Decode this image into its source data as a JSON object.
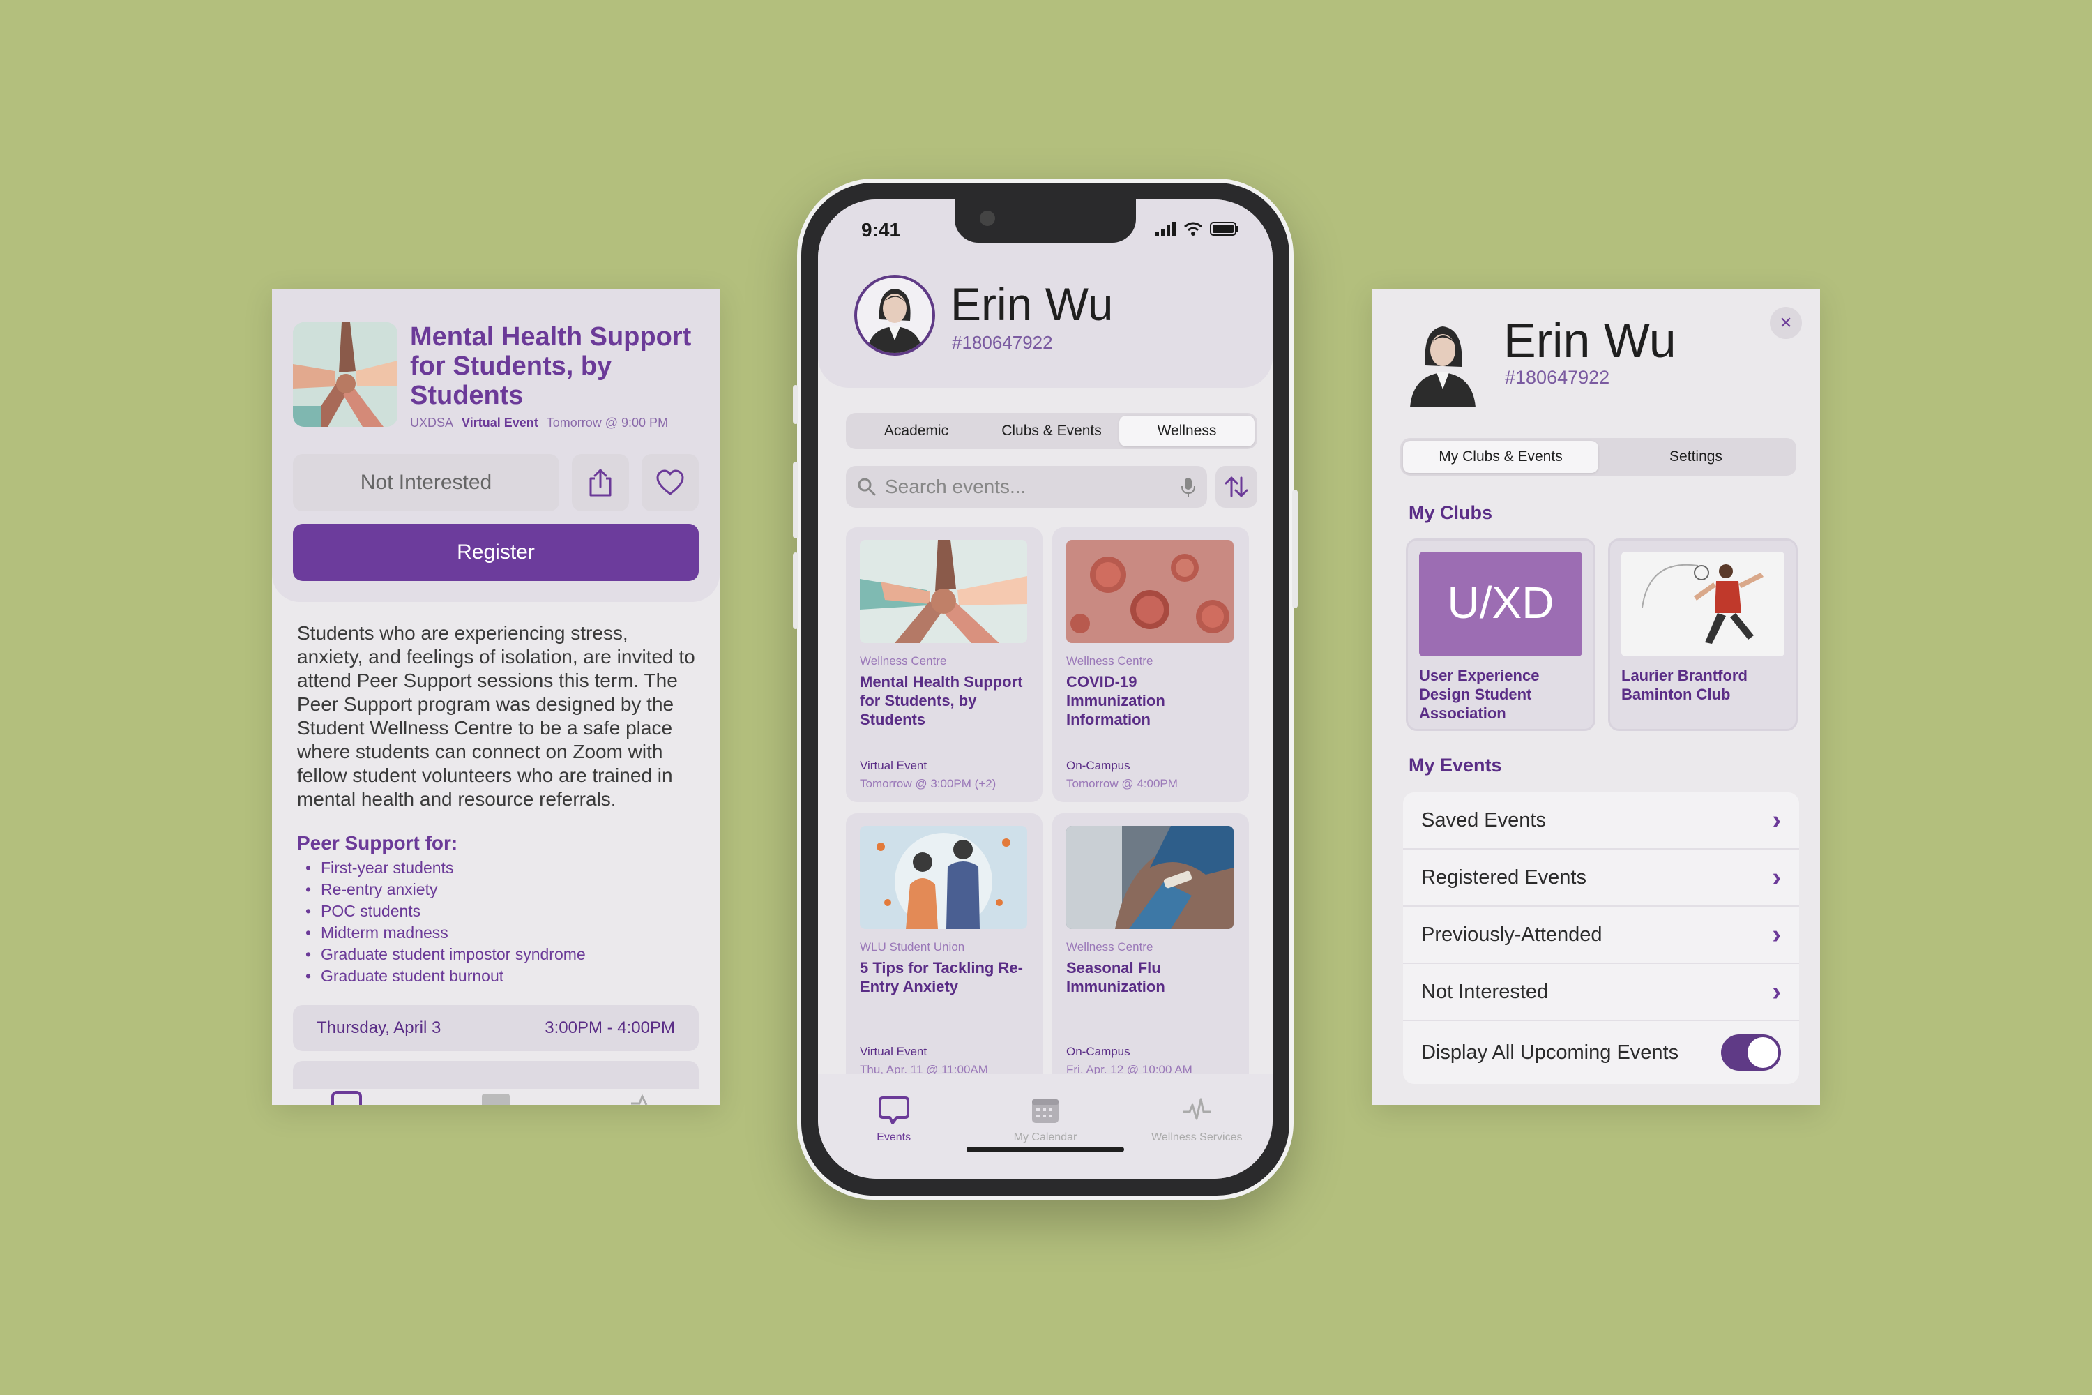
{
  "left_panel": {
    "title": "Mental Health Support for Students, by Students",
    "org": "UXDSA",
    "type": "Virtual Event",
    "time": "Tomorrow @ 9:00 PM",
    "not_interested_label": "Not Interested",
    "register_label": "Register",
    "description": "Students who are experiencing stress, anxiety, and feelings of isolation, are invited to attend Peer Support sessions this term. The Peer Support program was designed by the Student Wellness Centre to be a safe place where students can connect on Zoom with fellow student volunteers who are trained in mental health and resource referrals.",
    "peer_support_heading": "Peer Support for:",
    "peer_support_items": [
      "First-year students",
      "Re-entry anxiety",
      "POC students",
      "Midterm madness",
      "Graduate student impostor syndrome",
      "Graduate student burnout"
    ],
    "sessions": [
      {
        "day": "Thursday, April 3",
        "time": "3:00PM - 4:00PM"
      }
    ]
  },
  "phone": {
    "status_time": "9:41",
    "name": "Erin Wu",
    "student_id": "#180647922",
    "tabs": [
      "Academic",
      "Clubs & Events",
      "Wellness"
    ],
    "active_tab": "Wellness",
    "search_placeholder": "Search events...",
    "cards": [
      {
        "org": "Wellness Centre",
        "title": "Mental Health Support for Students, by Students",
        "type": "Virtual Event",
        "time": "Tomorrow @ 3:00PM (+2)"
      },
      {
        "org": "Wellness Centre",
        "title": "COVID-19 Immunization Information",
        "type": "On-Campus",
        "time": "Tomorrow @ 4:00PM"
      },
      {
        "org": "WLU Student Union",
        "title": "5 Tips for Tackling Re-Entry Anxiety",
        "type": "Virtual Event",
        "time": "Thu, Apr. 11 @ 11:00AM"
      },
      {
        "org": "Wellness Centre",
        "title": "Seasonal Flu Immunization",
        "type": "On-Campus",
        "time": "Fri, Apr. 12 @ 10:00 AM"
      }
    ],
    "tabbar": [
      {
        "label": "Events",
        "icon": "chat-bubble-icon",
        "active": true
      },
      {
        "label": "My Calendar",
        "icon": "calendar-icon",
        "active": false
      },
      {
        "label": "Wellness Services",
        "icon": "pulse-icon",
        "active": false
      }
    ]
  },
  "right_panel": {
    "name": "Erin Wu",
    "student_id": "#180647922",
    "close_icon": "×",
    "tabs": [
      "My Clubs & Events",
      "Settings"
    ],
    "active_tab": "My Clubs & Events",
    "my_clubs_heading": "My Clubs",
    "clubs": [
      {
        "name": "User Experience Design Student Association",
        "logo_text": "U/XD"
      },
      {
        "name": "Laurier Brantford Baminton Club"
      }
    ],
    "my_events_heading": "My Events",
    "event_rows": [
      "Saved Events",
      "Registered Events",
      "Previously-Attended",
      "Not Interested"
    ],
    "toggle_label": "Display All Upcoming Events",
    "toggle_on": true
  },
  "colors": {
    "background": "#b3bf7d",
    "accent_purple": "#6c3c9c",
    "panel": "#ebe9ec"
  }
}
